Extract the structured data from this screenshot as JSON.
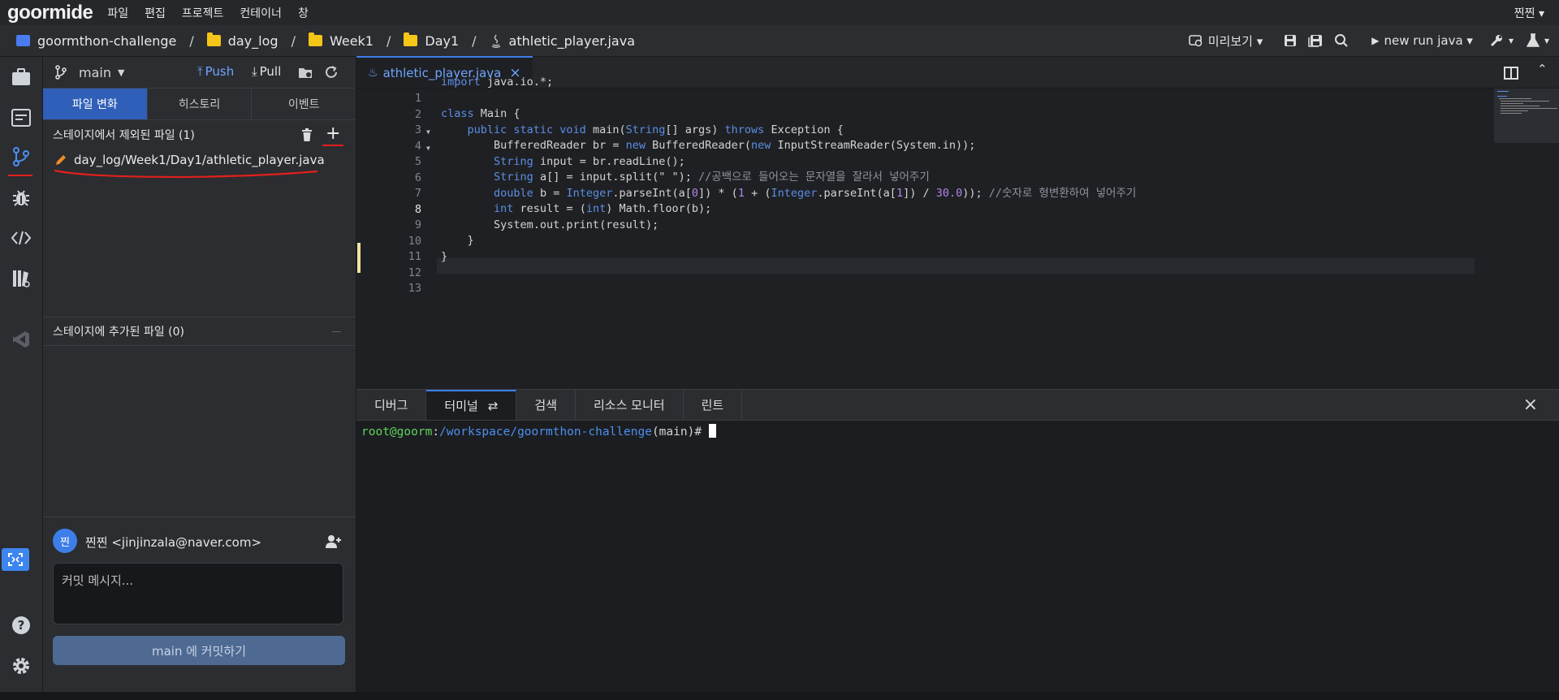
{
  "menubar": {
    "logo": "goormide",
    "items": [
      "파일",
      "편집",
      "프로젝트",
      "컨테이너",
      "창"
    ],
    "user": "찐찐 ▾"
  },
  "breadcrumb": {
    "items": [
      "goormthon-challenge",
      "day_log",
      "Week1",
      "Day1",
      "athletic_player.java"
    ],
    "separator": "/"
  },
  "toolbar": {
    "preview": "미리보기 ▾",
    "run_config": "new run java ▾",
    "tools_caret": "▾",
    "flask_caret": "▾"
  },
  "scm": {
    "branch": "main",
    "push": "Push",
    "pull": "Pull",
    "tabs": [
      "파일 변화",
      "히스토리",
      "이벤트"
    ],
    "unstaged_title": "스테이지에서 제외된 파일 (1)",
    "unstaged_files": [
      "day_log/Week1/Day1/athletic_player.java"
    ],
    "staged_title": "스테이지에 추가된 파일 (0)",
    "staged_collapse": "—",
    "author_avatar": "찐",
    "author": "찐찐 <jinjinzala@naver.com>",
    "commit_placeholder": "커밋 메시지...",
    "commit_button": "main 에 커밋하기"
  },
  "editor": {
    "tab": "athletic_player.java",
    "tab_close": "×",
    "current_line": 8,
    "line_numbers": [
      "1",
      "2",
      "3",
      "4",
      "5",
      "6",
      "7",
      "8",
      "9",
      "10",
      "11",
      "12",
      "13"
    ]
  },
  "panel": {
    "tabs": [
      "디버그",
      "터미널",
      "검색",
      "리소스 모니터",
      "린트"
    ],
    "active_tab": "터미널",
    "close": "×",
    "prompt_user": "root@goorm",
    "prompt_colon": ":",
    "prompt_path": "/workspace/goormthon-challenge",
    "prompt_branch": "(main)#"
  },
  "colors": {
    "accent": "#3d7ee8",
    "folder": "#f5c518",
    "keyword": "#5b8ee6",
    "number": "#b084eb",
    "annotation_red": "#e0201c"
  }
}
